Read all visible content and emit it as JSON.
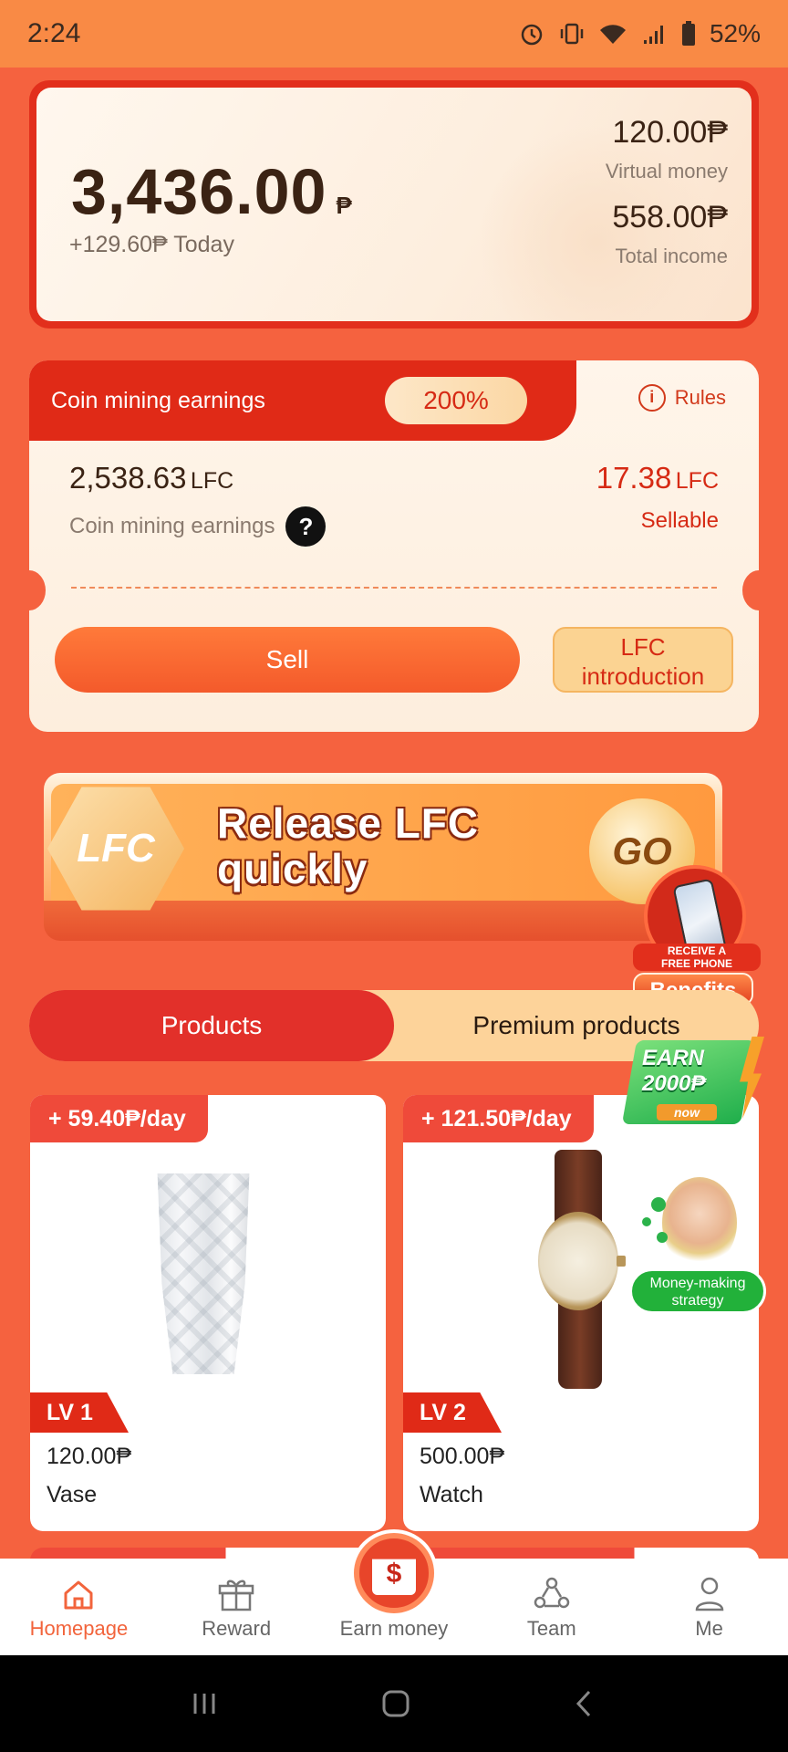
{
  "status_bar": {
    "time": "2:24",
    "battery": "52%",
    "icons": [
      "alarm-icon",
      "vibrate-icon",
      "wifi-icon",
      "signal-icon",
      "battery-icon"
    ]
  },
  "balance": {
    "amount": "3,436.00",
    "currency": "₱",
    "today": "+129.60₱ Today",
    "virtual_value": "120.00₱",
    "virtual_label": "Virtual money",
    "total_value": "558.00₱",
    "total_label": "Total income"
  },
  "mining": {
    "title": "Coin mining earnings",
    "percent": "200%",
    "rules_label": "Rules",
    "earnings_value": "2,538.63",
    "earnings_unit": "LFC",
    "earnings_label": "Coin mining earnings",
    "help": "?",
    "sellable_value": "17.38",
    "sellable_unit": "LFC",
    "sellable_label": "Sellable",
    "sell_button": "Sell",
    "intro_button_line1": "LFC",
    "intro_button_line2": "introduction"
  },
  "banner": {
    "logo_text": "LFC",
    "line1": "Release LFC",
    "line2": "quickly",
    "go": "GO"
  },
  "phone_badge": {
    "line1": "RECEIVE A",
    "line2": "FREE PHONE",
    "benefits": "Benefits"
  },
  "earn_badge": {
    "line1": "EARN",
    "line2": "2000₱",
    "now": "now"
  },
  "tabs": [
    {
      "label": "Products",
      "active": true
    },
    {
      "label": "Premium products",
      "active": false
    }
  ],
  "products": [
    {
      "rate": "+ 59.40₱/day",
      "level": "LV 1",
      "price": "120.00₱",
      "name": "Vase"
    },
    {
      "rate": "+ 121.50₱/day",
      "level": "LV 2",
      "price": "500.00₱",
      "name": "Watch"
    }
  ],
  "strategy_badge": {
    "label_line1": "Money-making",
    "label_line2": "strategy"
  },
  "bottom_nav": [
    {
      "label": "Homepage",
      "icon": "home-icon",
      "active": true
    },
    {
      "label": "Reward",
      "icon": "gift-icon",
      "active": false
    },
    {
      "label": "Earn money",
      "icon": "dollar-bag-icon",
      "active": false
    },
    {
      "label": "Team",
      "icon": "team-icon",
      "active": false
    },
    {
      "label": "Me",
      "icon": "user-icon",
      "active": false
    }
  ],
  "colors": {
    "accent": "#e02a17",
    "page_bg": "#f5623f",
    "active_nav": "#f2643c"
  }
}
